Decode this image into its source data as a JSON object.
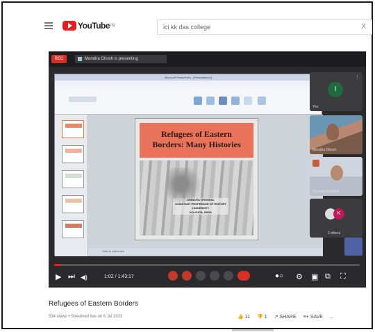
{
  "header": {
    "logo_text": "YouTube",
    "logo_sup": "IN",
    "search_value": "ici kk das college",
    "search_clear": "X"
  },
  "meet": {
    "rec_label": "REC",
    "presenting_label": "Mondira Ghosh is presenting"
  },
  "ppt": {
    "window_title": "Microsoft PowerPoint - [Presentation1]",
    "status_text": "Click to add notes"
  },
  "slide": {
    "title_line1": "Refugees of Eastern",
    "title_line2": "Borders: Many Histories",
    "caption_line1": "ANINDITA GHOSHAL",
    "caption_line2": "ASSISTANT PROFESSOR OF HISTORY",
    "caption_line3": "UNIVERSITY",
    "caption_line4": "KOLKATA, INDIA"
  },
  "participants": [
    {
      "name": "You",
      "avatar_letter": "I"
    },
    {
      "name": "Mondira Ghosh"
    },
    {
      "name": "Anindita Ghoshal"
    },
    {
      "name": "2 others",
      "avatar_letter": "K"
    }
  ],
  "player": {
    "time": "1:02 / 1:43:17",
    "progress_fraction": 0.02
  },
  "video": {
    "title": "Refugees of Eastern Borders",
    "meta": "534 views • Streamed live on 6 Jul 2023",
    "likes": "11",
    "dislikes": "1",
    "share_label": "SHARE",
    "save_label": "SAVE",
    "more": "..."
  }
}
